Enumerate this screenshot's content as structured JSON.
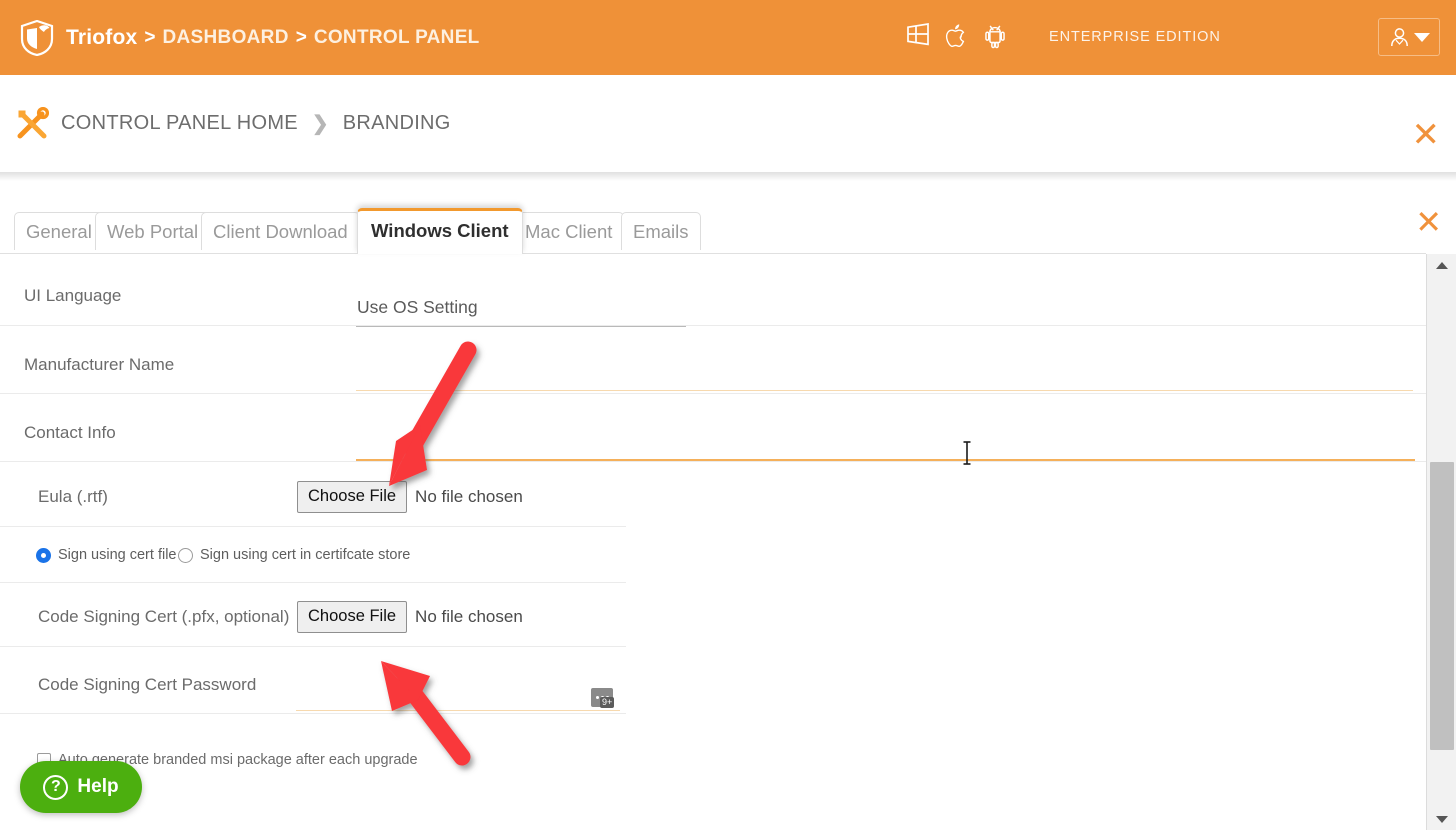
{
  "header": {
    "brand": "Triofox",
    "separator": ">",
    "crumb1": "DASHBOARD",
    "crumb2": "CONTROL PANEL",
    "edition": "ENTERPRISE EDITION",
    "os_icons": [
      "windows-icon",
      "apple-icon",
      "android-icon"
    ],
    "user_menu_icon": "user-avatar-icon",
    "accent_color": "#ef9138"
  },
  "breadcrumb": {
    "icon": "tools-icon",
    "home": "CONTROL PANEL HOME",
    "arrow": "❯",
    "current": "BRANDING",
    "close_label": "✕"
  },
  "panel": {
    "close_label": "✕",
    "tabs": [
      {
        "label": "General",
        "active": false
      },
      {
        "label": "Web Portal",
        "active": false
      },
      {
        "label": "Client Download",
        "active": false
      },
      {
        "label": "Windows Client",
        "active": true
      },
      {
        "label": "Mac Client",
        "active": false
      },
      {
        "label": "Emails",
        "active": false
      }
    ]
  },
  "form": {
    "ui_language": {
      "label": "UI Language",
      "value": "Use OS Setting"
    },
    "manufacturer_name": {
      "label": "Manufacturer Name",
      "value": ""
    },
    "contact_info": {
      "label": "Contact Info",
      "value": ""
    },
    "eula": {
      "label": "Eula (.rtf)",
      "button": "Choose File",
      "status": "No file chosen"
    },
    "sign_options": [
      {
        "label": "Sign using cert file",
        "selected": true
      },
      {
        "label": "Sign using cert in certifcate store",
        "selected": false
      }
    ],
    "code_signing_cert": {
      "label": "Code Signing Cert (.pfx, optional)",
      "button": "Choose File",
      "status": "No file chosen"
    },
    "code_signing_password": {
      "label": "Code Signing Cert Password",
      "value": "",
      "badge_icon": "password-manager-icon",
      "badge_count": "9+"
    },
    "auto_generate": {
      "label": "Auto generate branded msi package after each upgrade",
      "checked": false
    }
  },
  "help": {
    "label": "Help",
    "icon": "question-mark-icon",
    "color": "#4caf0f"
  },
  "scrollbar": {
    "up_icon": "triangle-up-icon",
    "down_icon": "triangle-down-icon"
  },
  "annotations": {
    "arrow1": "red-arrow-pointing-to-contact-info-field",
    "arrow2": "red-arrow-pointing-to-code-signing-cert-choose-file"
  }
}
